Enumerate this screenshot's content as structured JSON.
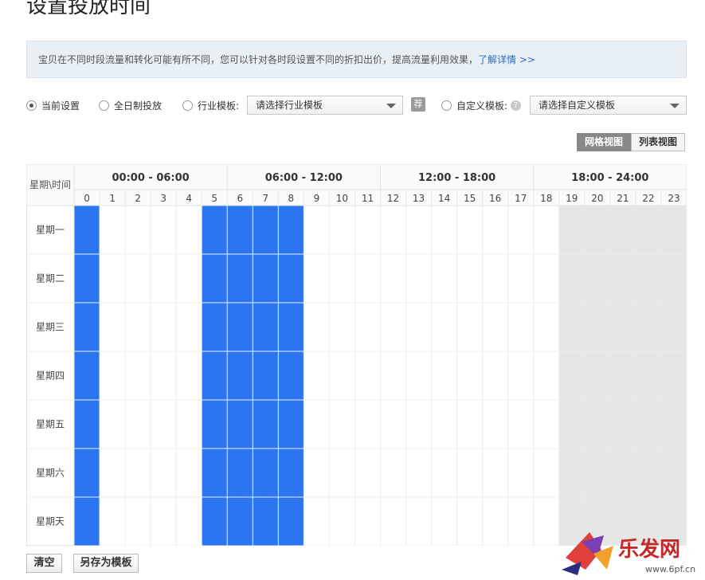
{
  "page": {
    "title": "设置投放时间"
  },
  "notice": {
    "text": "宝贝在不同时段流量和转化可能有所不同，您可以针对各时段设置不同的折扣出价，提高流量利用效果，",
    "link": "了解详情 >>"
  },
  "options": {
    "current": "当前设置",
    "allday": "全日制投放",
    "industry_label": "行业模板:",
    "industry_placeholder": "请选择行业模板",
    "rec_icon": "荐",
    "custom_label": "自定义模板:",
    "custom_placeholder": "请选择自定义模板",
    "help_icon": "?"
  },
  "views": {
    "grid": "网格视图",
    "list": "列表视图"
  },
  "grid": {
    "corner": "星期\\时间",
    "periods": [
      "00:00 - 06:00",
      "06:00 - 12:00",
      "12:00 - 18:00",
      "18:00 - 24:00"
    ],
    "hours": [
      "0",
      "1",
      "2",
      "3",
      "4",
      "5",
      "6",
      "7",
      "8",
      "9",
      "10",
      "11",
      "12",
      "13",
      "14",
      "15",
      "16",
      "17",
      "18",
      "19",
      "20",
      "21",
      "22",
      "23"
    ],
    "days": [
      "星期一",
      "星期二",
      "星期三",
      "星期四",
      "星期五",
      "星期六",
      "星期天"
    ],
    "selected_hours": [
      0,
      5,
      6,
      7,
      8
    ],
    "shaded_hours": [
      19,
      20,
      21,
      22,
      23
    ],
    "selected_color": "#2b76f0",
    "shaded_color": "#e6e6e6"
  },
  "buttons": {
    "clear": "清空",
    "save_template": "另存为模板"
  },
  "watermark": {
    "text": "乐发网",
    "site": "www.6pf.cn"
  }
}
